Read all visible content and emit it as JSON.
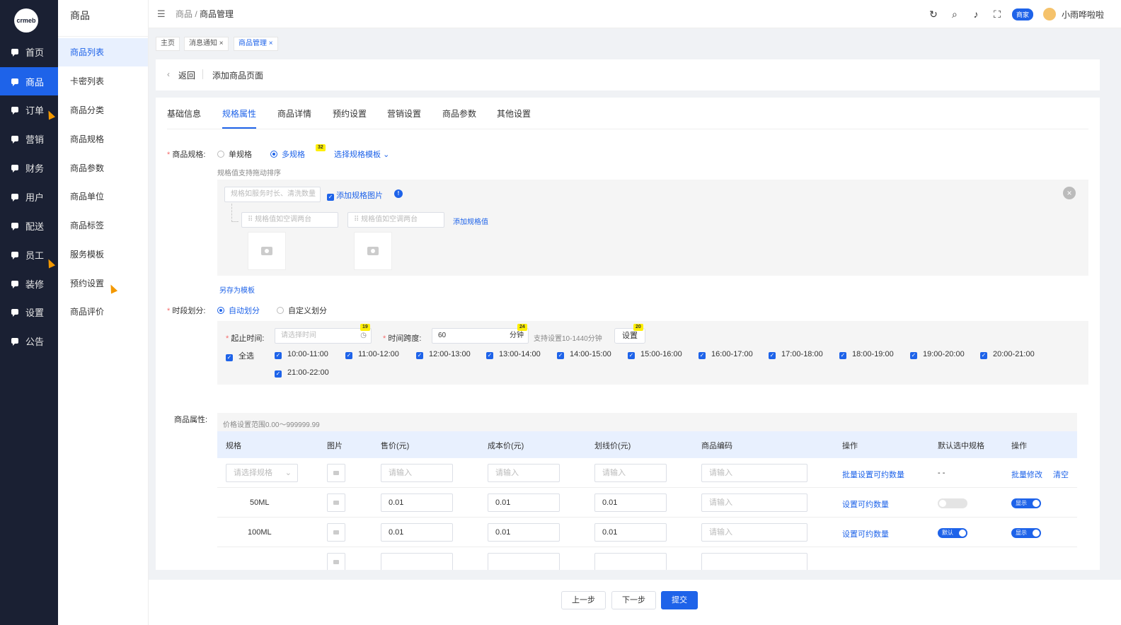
{
  "app": {
    "logo_text": "crmeb"
  },
  "sidebar": {
    "items": [
      {
        "label": "首页"
      },
      {
        "label": "商品"
      },
      {
        "label": "订单"
      },
      {
        "label": "营销"
      },
      {
        "label": "财务"
      },
      {
        "label": "用户"
      },
      {
        "label": "配送"
      },
      {
        "label": "员工"
      },
      {
        "label": "装修"
      },
      {
        "label": "设置"
      },
      {
        "label": "公告"
      }
    ]
  },
  "submenu": {
    "title": "商品",
    "items": [
      {
        "label": "商品列表"
      },
      {
        "label": "卡密列表"
      },
      {
        "label": "商品分类"
      },
      {
        "label": "商品规格"
      },
      {
        "label": "商品参数"
      },
      {
        "label": "商品单位"
      },
      {
        "label": "商品标签"
      },
      {
        "label": "服务模板"
      },
      {
        "label": "预约设置"
      },
      {
        "label": "商品评价"
      }
    ]
  },
  "topbar": {
    "breadcrumb_parent": "商品 /",
    "breadcrumb_current": "商品管理",
    "badge": "商家",
    "username": "小雨哗啦啦"
  },
  "tags": [
    {
      "label": "主页"
    },
    {
      "label": "消息通知 ×"
    },
    {
      "label": "商品管理 ×"
    }
  ],
  "header": {
    "back": "返回",
    "title": "添加商品页面"
  },
  "tabs": [
    {
      "label": "基础信息"
    },
    {
      "label": "规格属性"
    },
    {
      "label": "商品详情"
    },
    {
      "label": "预约设置"
    },
    {
      "label": "营销设置"
    },
    {
      "label": "商品参数"
    },
    {
      "label": "其他设置"
    }
  ],
  "spec": {
    "label": "商品规格:",
    "single": "单规格",
    "multi": "多规格",
    "template_link": "选择规格模板",
    "drag_hint": "规格值支持拖动排序",
    "spec_name_placeholder": "规格如服务时长、清洗数量",
    "add_image_label": "添加规格图片",
    "value_placeholder_1": "规格值如空调两台",
    "value_placeholder_2": "规格值如空调两台",
    "add_value_link": "添加规格值",
    "save_template": "另存为模板",
    "badge_value": "32"
  },
  "period": {
    "label": "时段划分:",
    "auto": "自动划分",
    "custom": "自定义划分",
    "start_label": "起止时间:",
    "start_placeholder": "请选择时间",
    "span_label": "时间跨度:",
    "span_value": "60",
    "span_unit": "分钟",
    "span_hint": "支持设置10-1440分钟",
    "set_button": "设置",
    "badge_start": "19",
    "badge_span": "24",
    "badge_set": "20",
    "select_all": "全选",
    "slots": [
      "10:00-11:00",
      "11:00-12:00",
      "12:00-13:00",
      "13:00-14:00",
      "14:00-15:00",
      "15:00-16:00",
      "16:00-17:00",
      "17:00-18:00",
      "18:00-19:00",
      "19:00-20:00",
      "20:00-21:00",
      "21:00-22:00"
    ]
  },
  "attributes": {
    "label": "商品属性:",
    "price_hint": "价格设置范围0.00～999999.99",
    "headers": [
      "规格",
      "图片",
      "售价(元)",
      "成本价(元)",
      "划线价(元)",
      "商品编码",
      "操作",
      "默认选中规格",
      "操作"
    ],
    "batch_row": {
      "spec_placeholder": "请选择规格",
      "input_placeholder": "请输入",
      "action": "批量设置可约数量",
      "default": "- -",
      "edit": "批量修改",
      "clear": "清空"
    },
    "rows": [
      {
        "spec": "50ML",
        "price": "0.01",
        "cost": "0.01",
        "line": "0.01",
        "code_placeholder": "请输入",
        "action": "设置可约数量",
        "default_label": "",
        "show_label": "显示"
      },
      {
        "spec": "100ML",
        "price": "0.01",
        "cost": "0.01",
        "line": "0.01",
        "code_placeholder": "请输入",
        "action": "设置可约数量",
        "default_label": "默认",
        "show_label": "显示"
      }
    ]
  },
  "footer": {
    "prev": "上一步",
    "next": "下一步",
    "submit": "提交"
  }
}
